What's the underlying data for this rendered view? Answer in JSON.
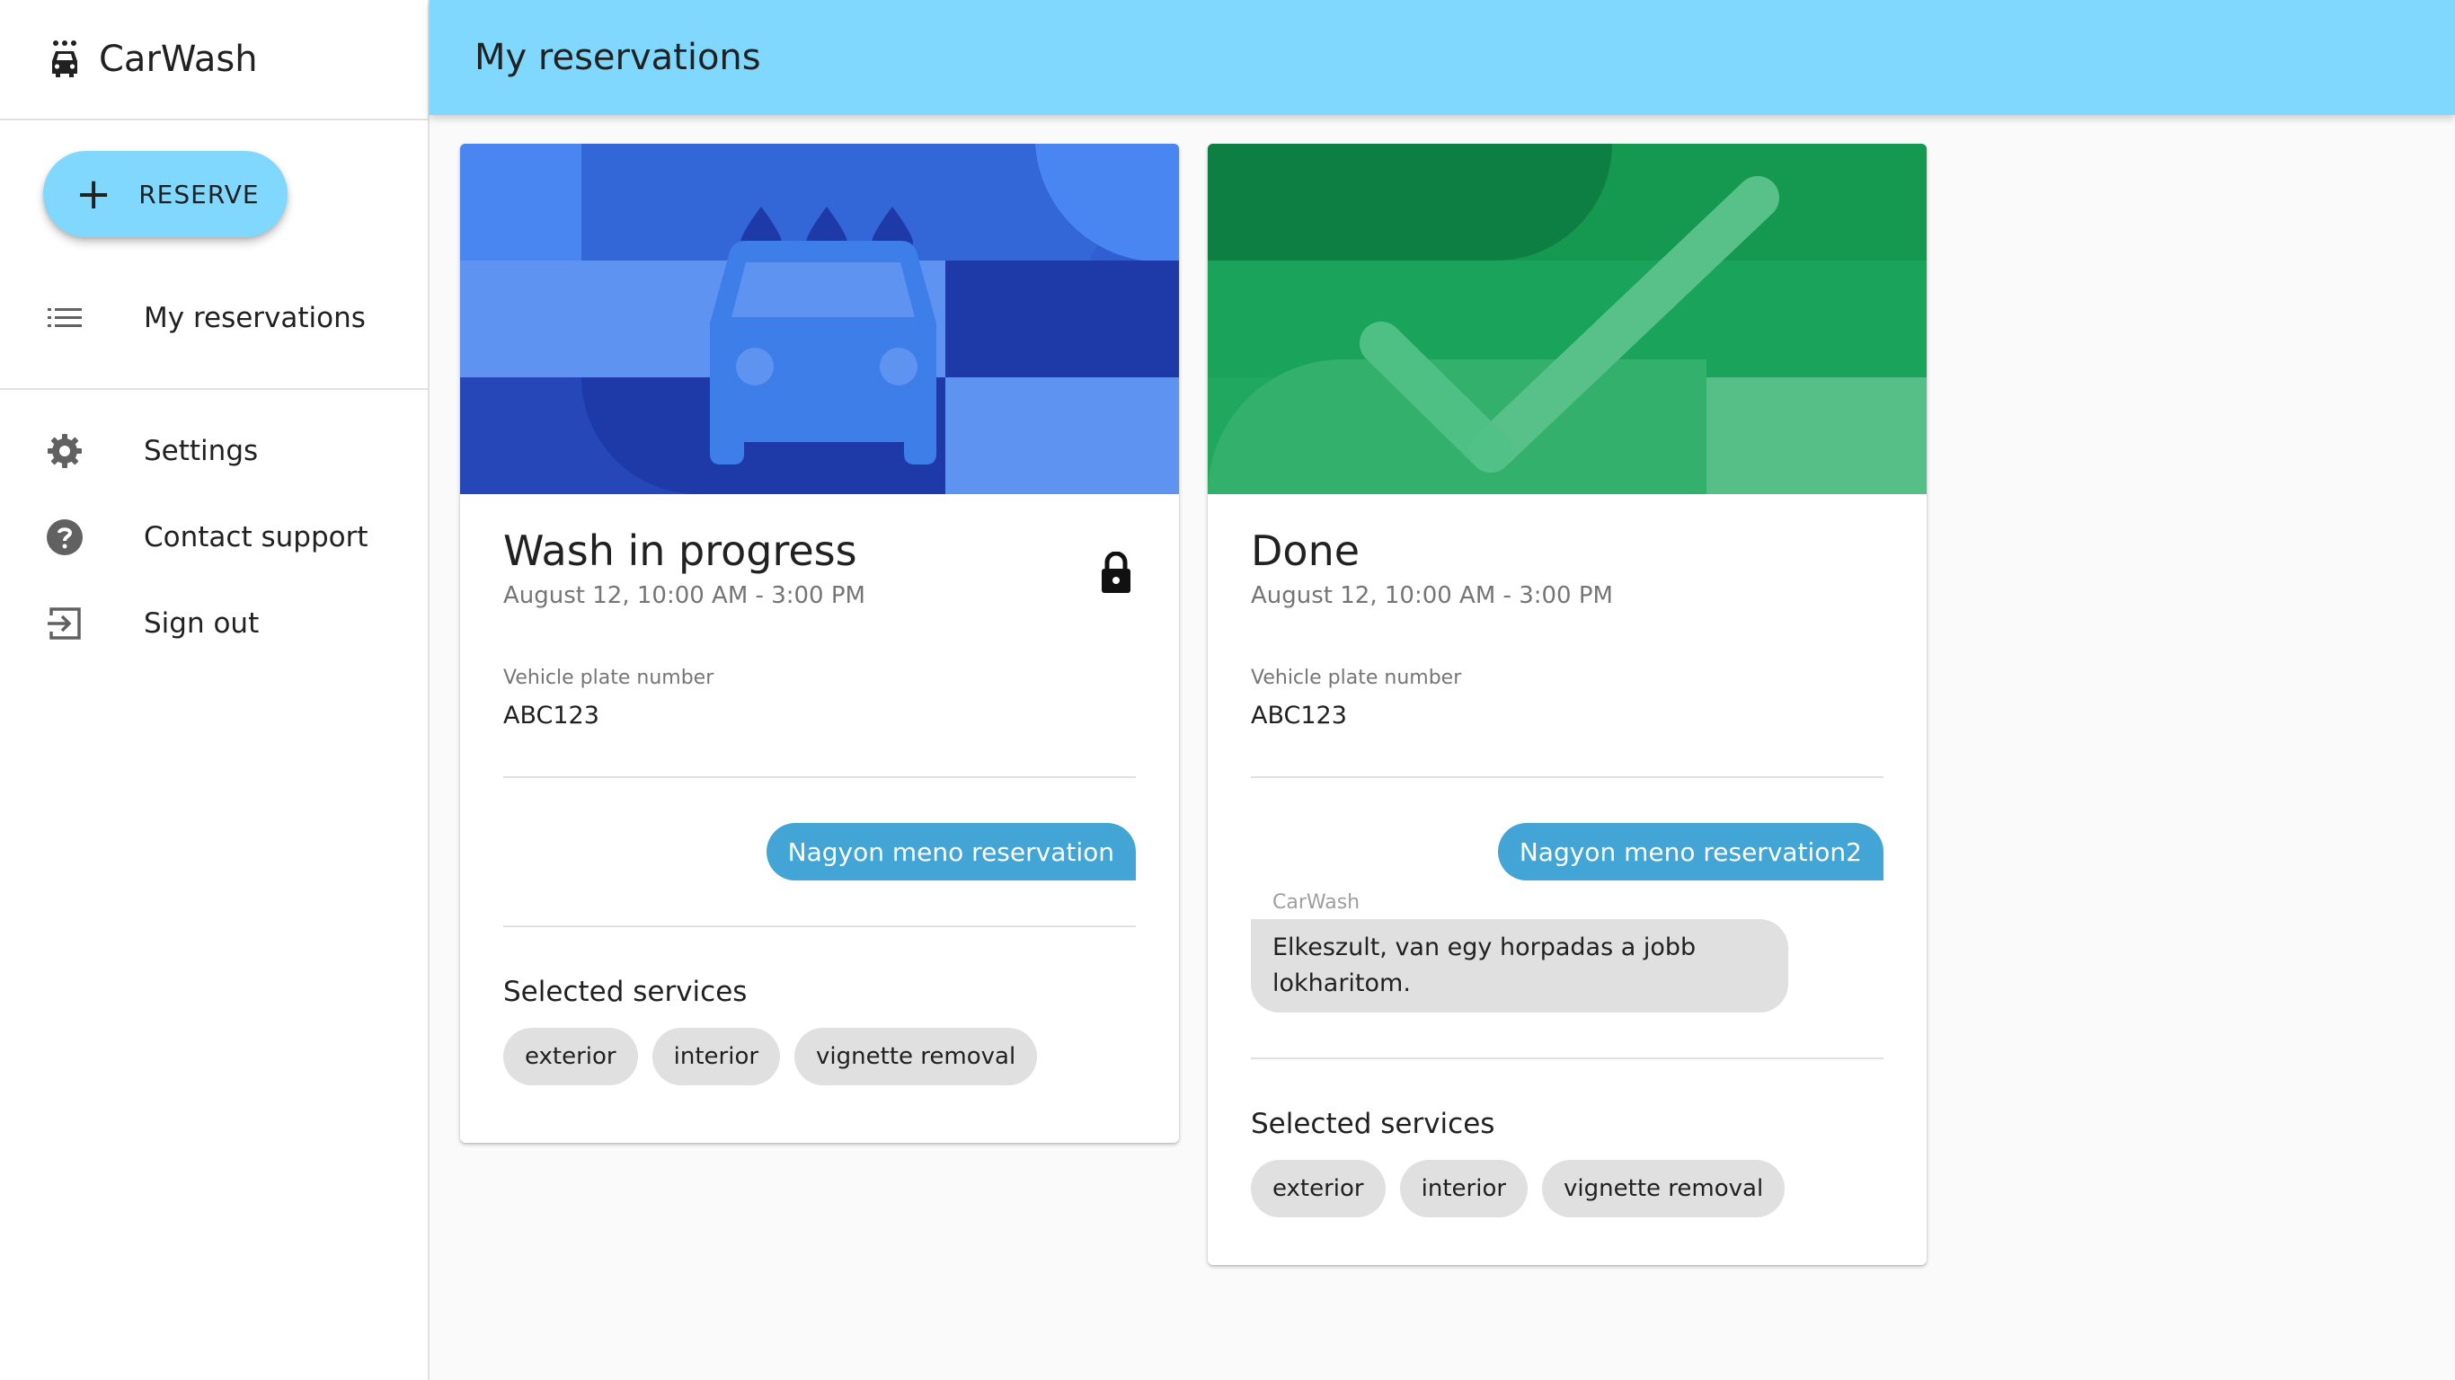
{
  "app": {
    "name": "CarWash",
    "icon": "car-wash-icon"
  },
  "sidebar": {
    "reserve_label": "RESERVE",
    "items": [
      {
        "label": "My reservations",
        "icon": "list-icon"
      },
      {
        "label": "Settings",
        "icon": "gear-icon"
      },
      {
        "label": "Contact support",
        "icon": "help-icon"
      },
      {
        "label": "Sign out",
        "icon": "sign-out-icon"
      }
    ]
  },
  "header": {
    "title": "My reservations"
  },
  "colors": {
    "accent": "#80d8ff",
    "own_message": "#42a5d5",
    "chip": "#e0e0e0",
    "in_progress": "#3f7ef0",
    "done": "#1aa35a"
  },
  "reservations": [
    {
      "status": "Wash in progress",
      "time": "August 12, 10:00 AM - 3:00 PM",
      "plate_label": "Vehicle plate number",
      "plate": "ABC123",
      "locked": true,
      "message_own": "Nagyon meno reservation",
      "services_title": "Selected services",
      "services": [
        "exterior",
        "interior",
        "vignette removal"
      ]
    },
    {
      "status": "Done",
      "time": "August 12, 10:00 AM - 3:00 PM",
      "plate_label": "Vehicle plate number",
      "plate": "ABC123",
      "locked": false,
      "message_own": "Nagyon meno reservation2",
      "reply_sender": "CarWash",
      "reply_text": "Elkeszult, van egy horpadas a jobb lokharitom.",
      "services_title": "Selected services",
      "services": [
        "exterior",
        "interior",
        "vignette removal"
      ]
    }
  ]
}
